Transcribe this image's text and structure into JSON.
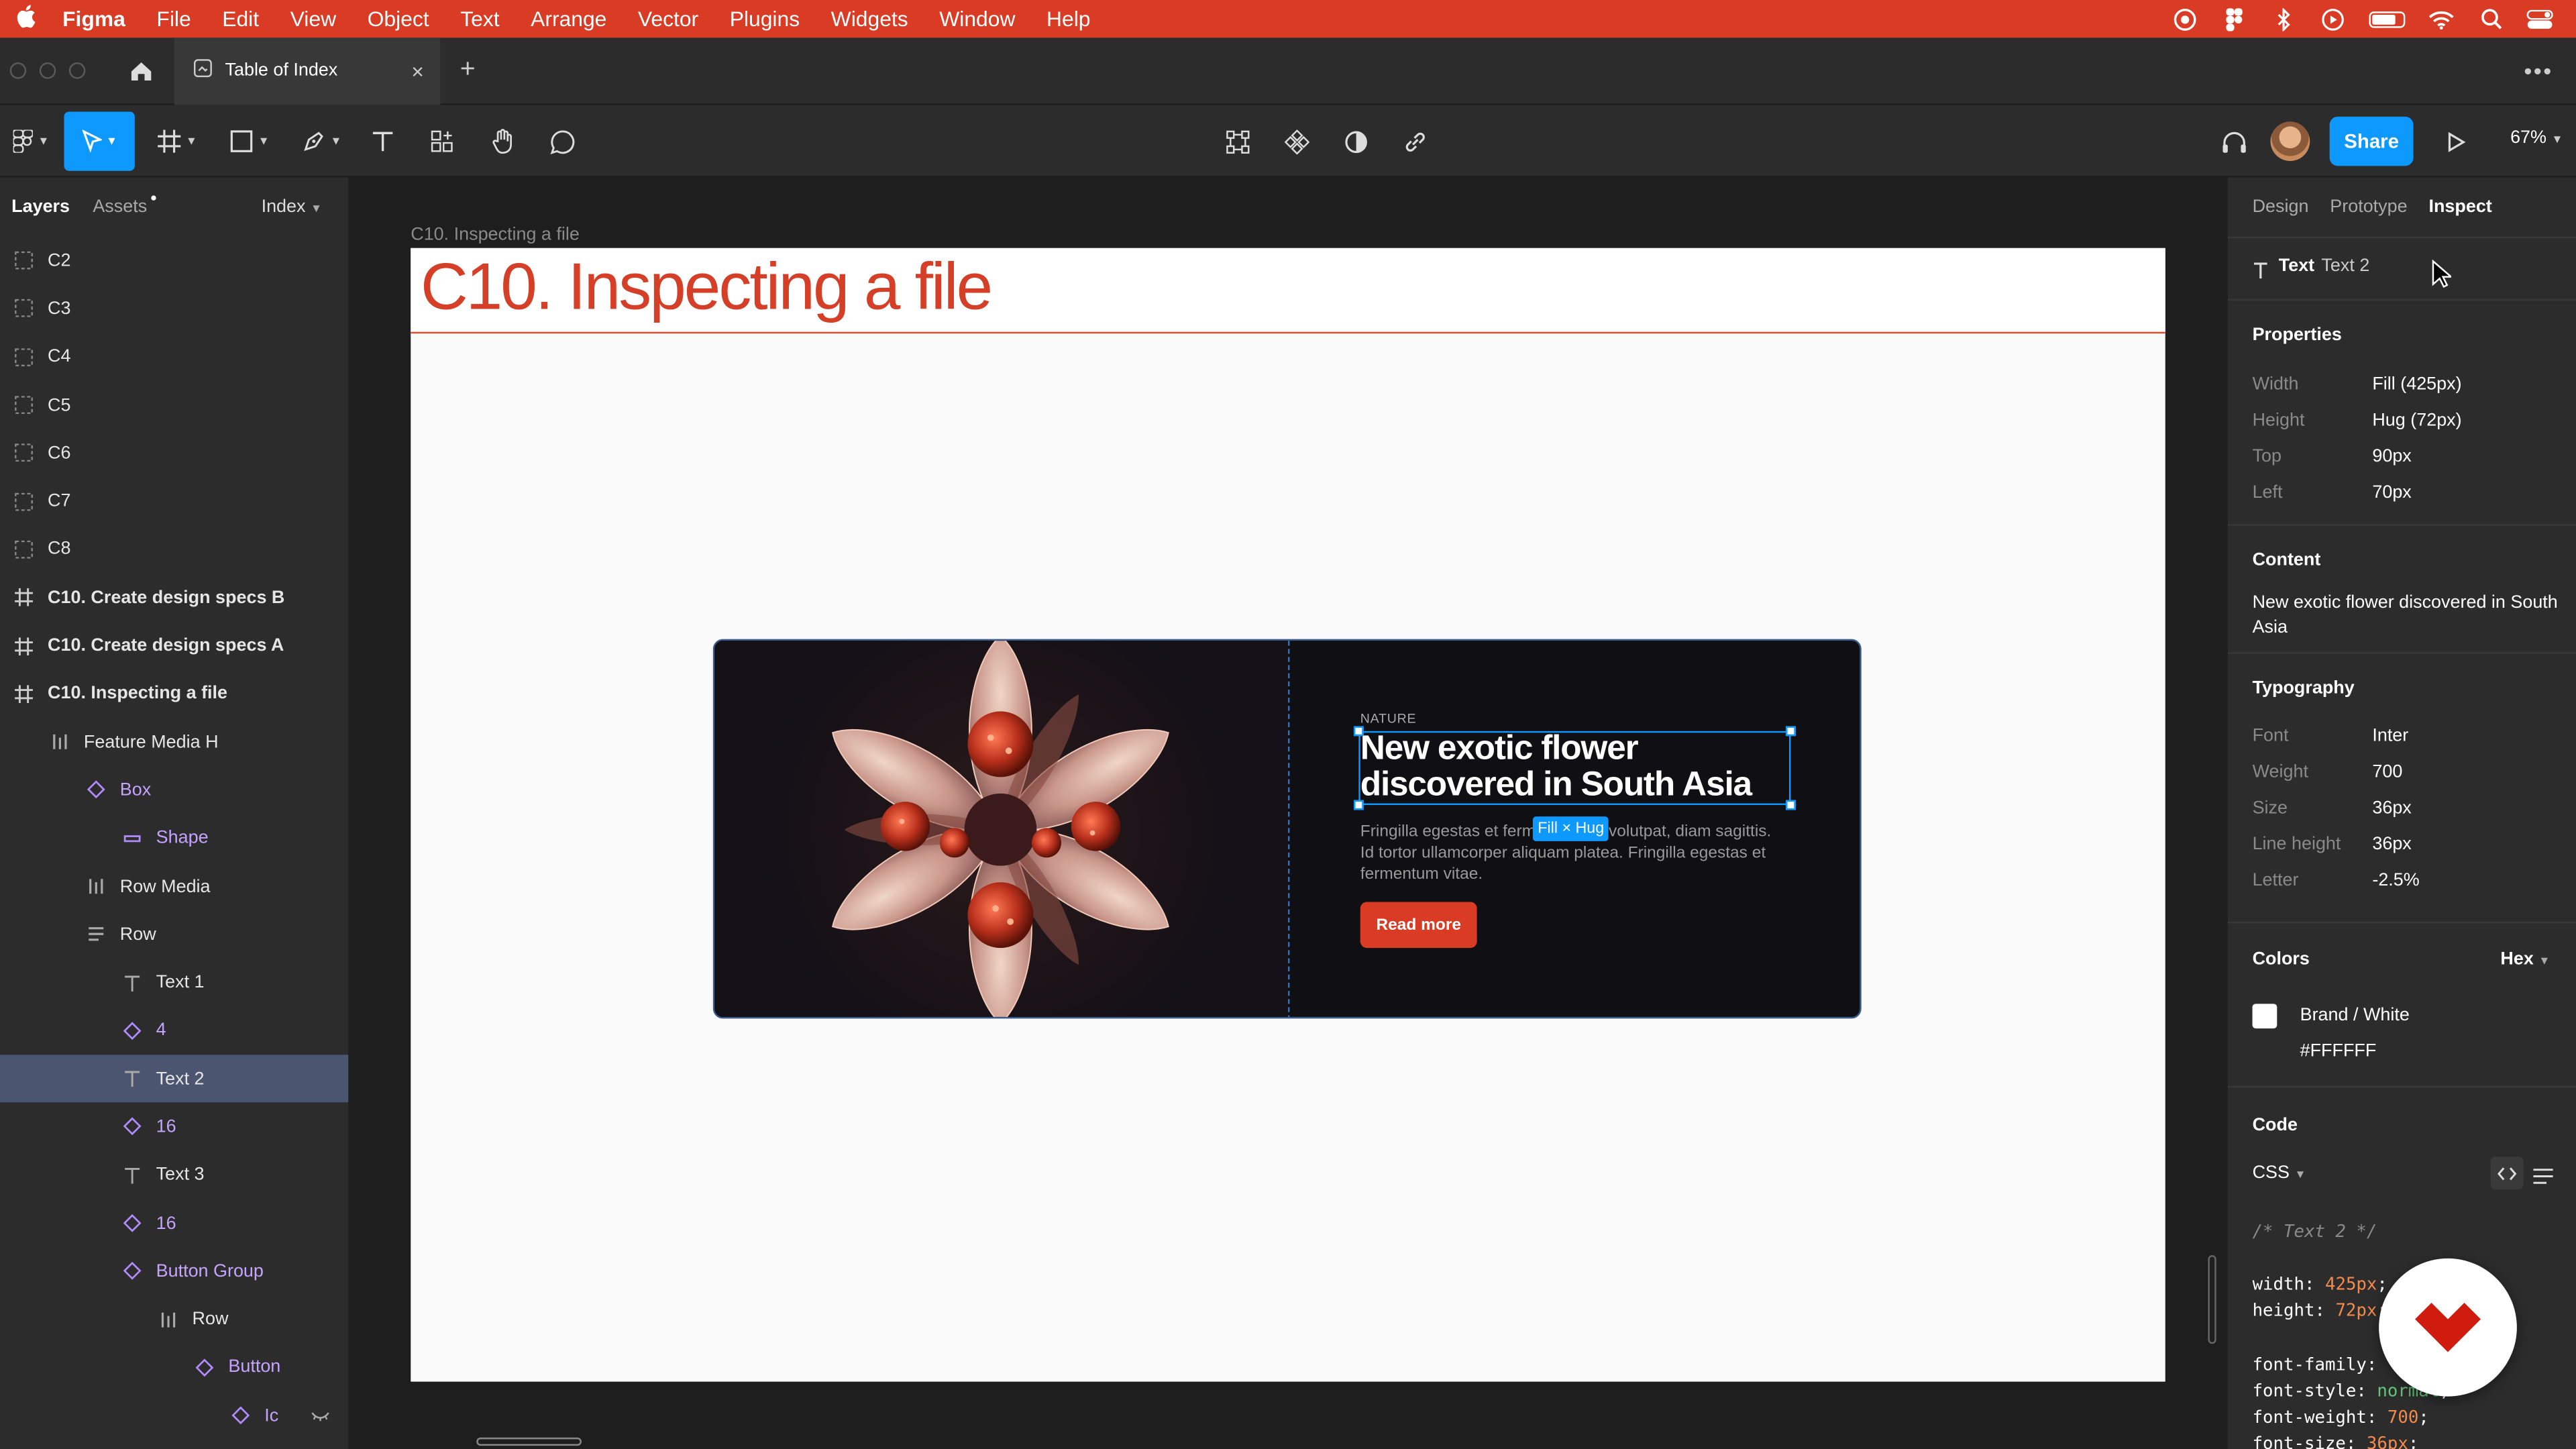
{
  "menubar": {
    "app_name": "Figma",
    "items": [
      "File",
      "Edit",
      "View",
      "Object",
      "Text",
      "Arrange",
      "Vector",
      "Plugins",
      "Widgets",
      "Window",
      "Help"
    ]
  },
  "tabbar": {
    "file_tab": "Table of Index"
  },
  "toolbar": {
    "share_label": "Share",
    "zoom": "67%"
  },
  "left_panel": {
    "tabs": {
      "layers": "Layers",
      "assets": "Assets"
    },
    "page": "Index",
    "layers": [
      {
        "label": "C2",
        "icon": "section-icon",
        "indent": 0
      },
      {
        "label": "C3",
        "icon": "section-icon",
        "indent": 0
      },
      {
        "label": "C4",
        "icon": "section-icon",
        "indent": 0
      },
      {
        "label": "C5",
        "icon": "section-icon",
        "indent": 0
      },
      {
        "label": "C6",
        "icon": "section-icon",
        "indent": 0
      },
      {
        "label": "C7",
        "icon": "section-icon",
        "indent": 0
      },
      {
        "label": "C8",
        "icon": "section-icon",
        "indent": 0
      },
      {
        "label": "C10. Create design specs B",
        "icon": "frame-icon",
        "indent": 0
      },
      {
        "label": "C10. Create design specs A",
        "icon": "frame-icon",
        "indent": 0
      },
      {
        "label": "C10. Inspecting a file",
        "icon": "frame-icon",
        "indent": 0
      },
      {
        "label": "Feature Media H",
        "icon": "auto-layout-h-icon",
        "indent": 1
      },
      {
        "label": "Box",
        "icon": "component-instance-icon",
        "indent": 2
      },
      {
        "label": "Shape",
        "icon": "rectangle-icon",
        "indent": 3
      },
      {
        "label": "Row Media",
        "icon": "auto-layout-h-icon",
        "indent": 2
      },
      {
        "label": "Row",
        "icon": "auto-layout-v-icon",
        "indent": 2
      },
      {
        "label": "Text 1",
        "icon": "text-icon",
        "indent": 3
      },
      {
        "label": "4",
        "icon": "component-instance-icon",
        "indent": 3
      },
      {
        "label": "Text 2",
        "icon": "text-icon",
        "indent": 3
      },
      {
        "label": "16",
        "icon": "component-instance-icon",
        "indent": 3
      },
      {
        "label": "Text 3",
        "icon": "text-icon",
        "indent": 3
      },
      {
        "label": "16",
        "icon": "component-instance-icon",
        "indent": 3
      },
      {
        "label": "Button Group",
        "icon": "component-instance-icon",
        "indent": 3
      },
      {
        "label": "Row",
        "icon": "auto-layout-h-icon",
        "indent": 4
      },
      {
        "label": "Button",
        "icon": "component-instance-icon",
        "indent": 5
      },
      {
        "label": "Ic",
        "icon": "component-instance-icon",
        "indent": 6
      }
    ]
  },
  "canvas": {
    "frame_label": "C10. Inspecting a file",
    "frame_title": "C10.  Inspecting a file",
    "card": {
      "kicker": "NATURE",
      "headline": "New exotic flower discovered in South Asia",
      "body": "Fringilla egestas et fermentum ae volutpat, diam sagittis. Id tortor ullamcorper aliquam platea. Fringilla egestas et fermentum vitae.",
      "size_badge": "Fill × Hug",
      "button": "Read more"
    }
  },
  "right_panel": {
    "tabs": {
      "design": "Design",
      "prototype": "Prototype",
      "inspect": "Inspect"
    },
    "layer_type": "Text",
    "layer_name": "Text 2",
    "properties": {
      "heading": "Properties",
      "rows": [
        {
          "key": "Width",
          "value": "Fill (425px)"
        },
        {
          "key": "Height",
          "value": "Hug (72px)"
        },
        {
          "key": "Top",
          "value": "90px"
        },
        {
          "key": "Left",
          "value": "70px"
        }
      ]
    },
    "content": {
      "heading": "Content",
      "text": "New exotic flower discovered in South Asia"
    },
    "typography": {
      "heading": "Typography",
      "rows": [
        {
          "key": "Font",
          "value": "Inter"
        },
        {
          "key": "Weight",
          "value": "700"
        },
        {
          "key": "Size",
          "value": "36px"
        },
        {
          "key": "Line height",
          "value": "36px"
        },
        {
          "key": "Letter",
          "value": "-2.5%"
        }
      ]
    },
    "colors": {
      "heading": "Colors",
      "format": "Hex",
      "name": "Brand / White",
      "hex": "#FFFFFF"
    },
    "code": {
      "heading": "Code",
      "language": "CSS",
      "comment": "/* Text 2 */",
      "lines": [
        {
          "prop": "width: ",
          "val": "425px",
          "cls": "n"
        },
        {
          "prop": "height: ",
          "val": "72px",
          "cls": "n"
        },
        {
          "prop": "font-family: ",
          "val": "'",
          "cls": "g"
        },
        {
          "prop": "font-style: ",
          "val": "normal",
          "cls": "g"
        },
        {
          "prop": "font-weight: ",
          "val": "700",
          "cls": "n"
        },
        {
          "prop": "font-size: ",
          "val": "36px",
          "cls": "n"
        }
      ]
    }
  },
  "colors": {
    "accent": "#d93b25",
    "selection": "#0d99ff",
    "panel": "#2c2c2c",
    "canvas": "#1e1e1e"
  }
}
